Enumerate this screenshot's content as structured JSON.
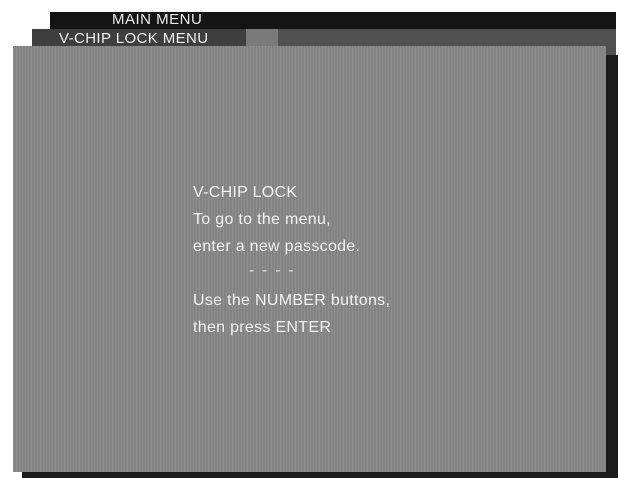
{
  "main_menu": {
    "title": "MAIN MENU"
  },
  "vchip_menu": {
    "title": "V-CHIP LOCK MENU"
  },
  "screen": {
    "heading": "V-CHIP LOCK",
    "line1": "To go to the menu,",
    "line2": "enter a new passcode.",
    "passcode_entry": "- - - -",
    "line3": "Use the NUMBER buttons,",
    "line4": "then press ENTER"
  },
  "colors": {
    "main_menu_bg": "#141414",
    "vchip_menu_bg": "#505050",
    "screen_bg": "#888888",
    "text": "#f2f2f2"
  }
}
